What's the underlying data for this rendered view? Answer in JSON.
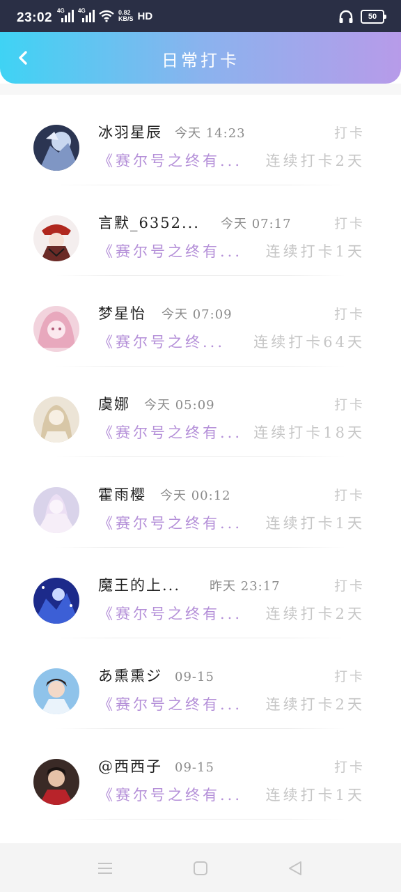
{
  "status_bar": {
    "time": "23:02",
    "signal1_label": "4G",
    "signal2_label": "4G",
    "speed_value": "0.82",
    "speed_unit": "KB/S",
    "hd_label": "HD",
    "battery": "50"
  },
  "header": {
    "title": "日常打卡",
    "gradient_start": "#3fd3f4",
    "gradient_end": "#b79be9"
  },
  "checkins": [
    {
      "name": "冰羽星辰",
      "time": "今天 14:23",
      "action": "打卡",
      "book": "《赛尔号之终有...",
      "streak": "连续打卡2天"
    },
    {
      "name": "言默_6352...",
      "time": "今天 07:17",
      "action": "打卡",
      "book": "《赛尔号之终有...",
      "streak": "连续打卡1天"
    },
    {
      "name": "梦星怡",
      "time": "今天 07:09",
      "action": "打卡",
      "book": "《赛尔号之终...",
      "streak": "连续打卡64天"
    },
    {
      "name": "虞娜",
      "time": "今天 05:09",
      "action": "打卡",
      "book": "《赛尔号之终有...",
      "streak": "连续打卡18天"
    },
    {
      "name": "霍雨樱",
      "time": "今天 00:12",
      "action": "打卡",
      "book": "《赛尔号之终有...",
      "streak": "连续打卡1天"
    },
    {
      "name": "魔王的上...",
      "time": "昨天 23:17",
      "action": "打卡",
      "book": "《赛尔号之终有...",
      "streak": "连续打卡2天"
    },
    {
      "name": "あ熏熏ジ",
      "time": "09-15",
      "action": "打卡",
      "book": "《赛尔号之终有...",
      "streak": "连续打卡2天"
    },
    {
      "name": "@西西子",
      "time": "09-15",
      "action": "打卡",
      "book": "《赛尔号之终有...",
      "streak": "连续打卡1天"
    }
  ],
  "colors": {
    "accent_purple": "#b48fd8",
    "muted_gray": "#c6c6c6"
  }
}
